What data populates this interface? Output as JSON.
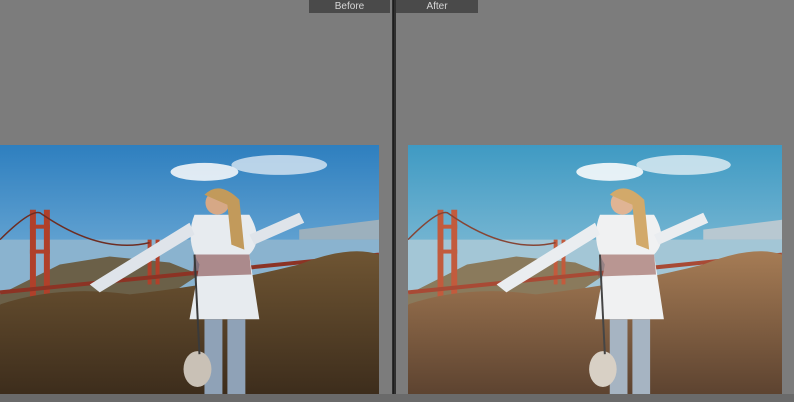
{
  "compare_view": {
    "before_label": "Before",
    "after_label": "After"
  },
  "colors": {
    "background": "#7c7c7c",
    "label_bg": "#4a4a4a",
    "label_text": "#d7d7d7",
    "divider": "#2f2f2f"
  }
}
